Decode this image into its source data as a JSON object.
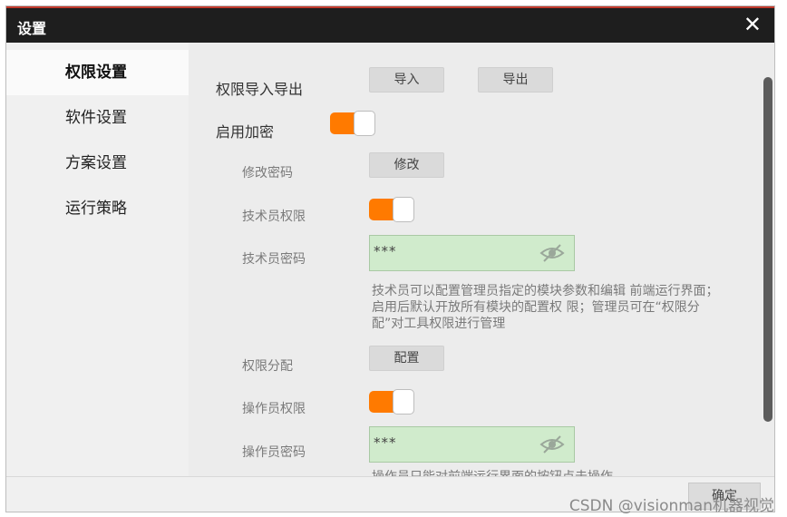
{
  "window": {
    "title": "设置",
    "close_symbol": "✕"
  },
  "sidebar": {
    "items": [
      {
        "label": "权限设置",
        "active": true
      },
      {
        "label": "软件设置"
      },
      {
        "label": "方案设置"
      },
      {
        "label": "运行策略"
      }
    ]
  },
  "permissions": {
    "import_export_label": "权限导入导出",
    "import_button": "导入",
    "export_button": "导出",
    "enable_encryption_label": "启用加密",
    "enable_encryption_on": true,
    "change_password_label": "修改密码",
    "change_button": "修改",
    "technician_permission_label": "技术员权限",
    "technician_permission_on": true,
    "technician_password_label": "技术员密码",
    "technician_password_value": "***",
    "technician_note": "技术员可以配置管理员指定的模块参数和编辑 前端运行界面；启用后默认开放所有模块的配置权 限；管理员可在“权限分配”对工具权限进行管理",
    "assign_label": "权限分配",
    "config_button": "配置",
    "operator_permission_label": "操作员权限",
    "operator_permission_on": true,
    "operator_password_label": "操作员密码",
    "operator_password_value": "***",
    "operator_note": "操作员只能对前端运行界面的按钮点击操作"
  },
  "footer": {
    "ok_button": "确定"
  },
  "watermark": "CSDN @visionman机器视觉",
  "colors": {
    "toggle_on": "#ff7a00",
    "password_bg": "#d0ebcc",
    "titlebar": "#1e1e1e"
  },
  "icons": {
    "close": "close-icon",
    "password_visibility": "eye-slash-icon"
  }
}
